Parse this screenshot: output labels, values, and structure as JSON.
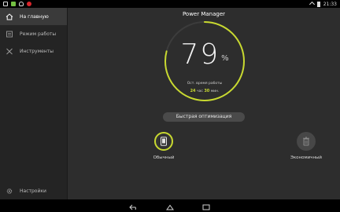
{
  "statusbar": {
    "time": "21:33"
  },
  "sidebar": {
    "items": [
      {
        "label": "На главную",
        "icon": "home-icon",
        "active": true
      },
      {
        "label": "Режим работы",
        "icon": "mode-icon",
        "active": false
      },
      {
        "label": "Инструменты",
        "icon": "tools-icon",
        "active": false
      }
    ],
    "settings_label": "Настройки"
  },
  "main": {
    "title": "Power Manager",
    "battery_percent": "79",
    "percent_sign": "%",
    "remaining_label": "Ост. время работы",
    "remaining_hours": "24",
    "hours_unit": "час",
    "remaining_minutes": "30",
    "minutes_unit": "мин.",
    "optimize_label": "Быстрая оптимизация",
    "modes": [
      {
        "label": "Обычный",
        "icon": "phone-icon",
        "selected": true
      },
      {
        "label": "Экономичный",
        "icon": "trash-icon",
        "selected": false
      }
    ]
  },
  "colors": {
    "accent": "#c8d930",
    "background": "#2d2d2d",
    "sidebar": "#242424"
  }
}
